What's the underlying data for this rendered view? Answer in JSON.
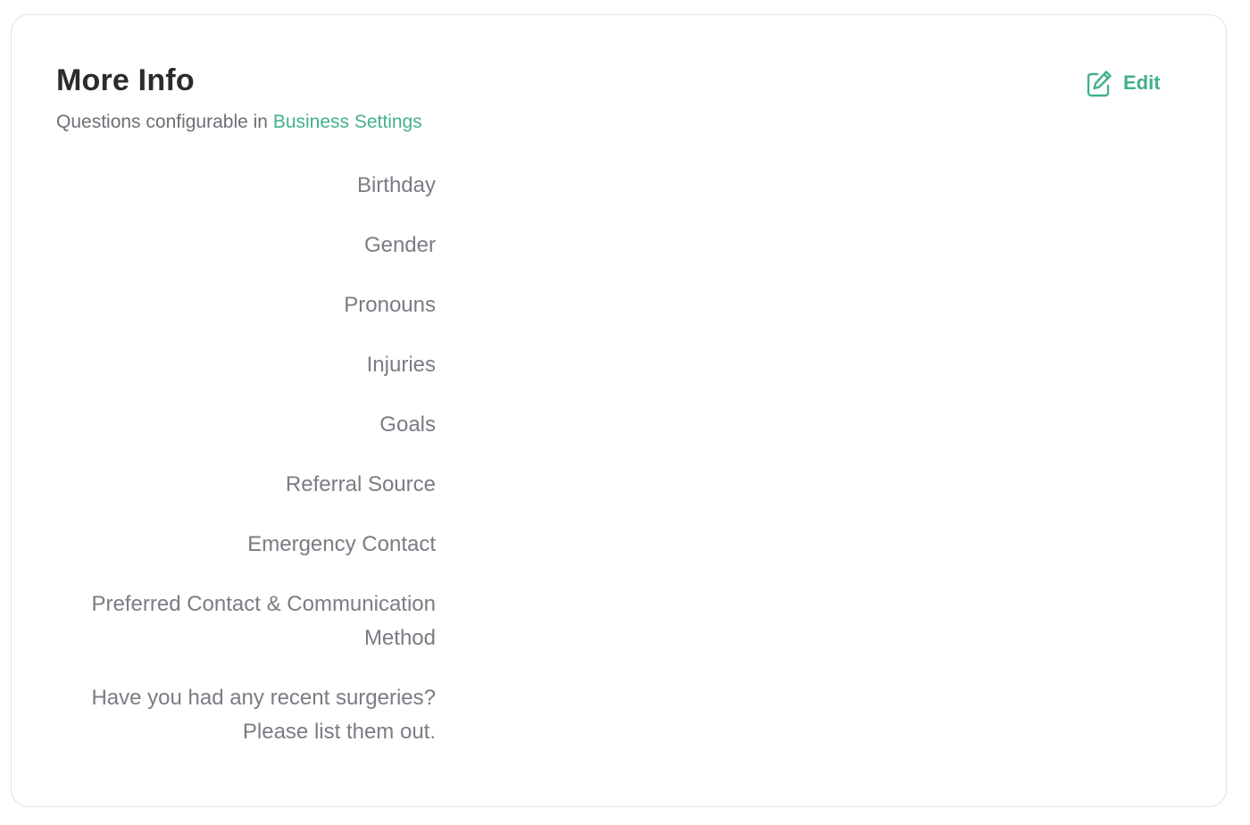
{
  "header": {
    "title": "More Info",
    "subtitle_prefix": "Questions configurable in ",
    "subtitle_link": "Business Settings",
    "edit_label": "Edit"
  },
  "fields": [
    {
      "label": "Birthday"
    },
    {
      "label": "Gender"
    },
    {
      "label": "Pronouns"
    },
    {
      "label": "Injuries"
    },
    {
      "label": "Goals"
    },
    {
      "label": "Referral Source"
    },
    {
      "label": "Emergency Contact"
    },
    {
      "label": "Preferred Contact & Communication Method"
    },
    {
      "label": "Have you had any recent surgeries? Please list them out."
    }
  ],
  "colors": {
    "accent": "#43b08c",
    "label": "#7b7b84",
    "title": "#2b2b2e",
    "border": "#e3e3e6"
  },
  "icons": {
    "edit": "pencil-square-icon"
  }
}
